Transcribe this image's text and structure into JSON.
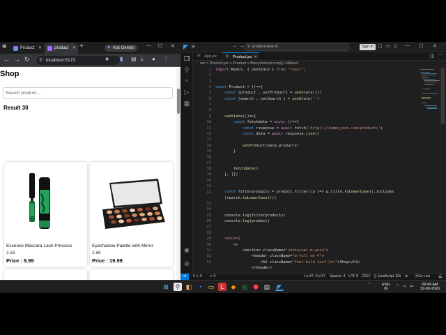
{
  "browser": {
    "tabs": [
      {
        "label": "Product"
      },
      {
        "label": "product"
      }
    ],
    "gemini_label": "Ask Gemini",
    "url": "localhost:5173"
  },
  "page": {
    "title": "Shop",
    "search_placeholder": "Search product....",
    "result_label": "Result 30",
    "products": [
      {
        "name": "Essence Mascara Lash Princess",
        "rating": "2.56",
        "price": "Price : 9.99"
      },
      {
        "name": "Eyeshadow Palette with Mirror",
        "rating": "2.86",
        "price": "Price : 19.99"
      }
    ]
  },
  "vscode": {
    "search_text": "product-search",
    "signin_label": "Sign in",
    "tabs": [
      {
        "label": "App.jsx"
      },
      {
        "label": "Product.jsx"
      }
    ],
    "breadcrumb": "src > Product.jsx > Product > filterproducts.map() callback",
    "line_numbers": [
      "1",
      "2",
      "3",
      "4",
      "5",
      "6",
      "7",
      "8",
      "9",
      "10",
      "11",
      "12",
      "13",
      "14",
      "15",
      "16",
      "17",
      "18",
      "19",
      "20",
      "21",
      "22",
      "23",
      "24",
      "25",
      "26",
      "27",
      "28",
      "29",
      "30",
      "31",
      "32",
      "33"
    ],
    "code": [
      "import React, { useState } from \"react\";",
      "",
      "",
      "const Product = ()=>{",
      "    const [product , setProduct] = useState([])",
      "    const [search , setSearch ] = useState('')",
      "",
      "",
      "    useState(()=>{",
      "        const fetchdata = async ()=>{",
      "            const response = await fetch('https://dummyjson.com/products')",
      "            const data = await response.json()",
      "",
      "            setProduct(data.products)",
      "        }",
      "",
      "",
      "        fetchdata()",
      "    }, [])",
      "",
      "",
      "    const filterproducts = product.filter((p )=> p.title.toLowerCase().includes",
      "    (search.toLowerCase()))",
      "",
      "",
      "    console.log(filterproducts)",
      "    console.log(product)",
      "",
      "",
      "    return(",
      "        <>",
      "            <section className=\"container m-auto\">",
      "                <header className=\"w-full mt-4\">",
      "                    <h1 className=\"font-bold text-2xl\">Shop</h1>",
      "                </header>"
    ],
    "status": {
      "errors": "0 ⚠ 0",
      "position": "Ln 47, Col 37",
      "spaces": "Spaces: 4",
      "encoding": "UTF-8",
      "eol": "CRLF",
      "language": "{} JavaScript JSX",
      "golive": "Go Live"
    }
  },
  "taskbar": {
    "lang": "ENG",
    "region": "IN",
    "time": "09:49 AM",
    "date": "19-09-2026"
  },
  "colors": {
    "vscode_accent": "#0078d4",
    "taskbar_bg": "#202020",
    "page_bg": "#ffffff"
  }
}
